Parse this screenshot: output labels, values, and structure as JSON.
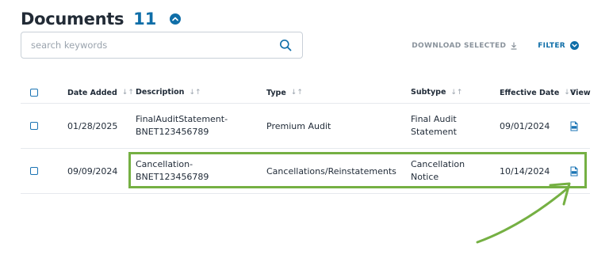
{
  "header": {
    "title": "Documents",
    "count": "11"
  },
  "search": {
    "placeholder": "search keywords",
    "value": ""
  },
  "actions": {
    "download_label": "DOWNLOAD SELECTED",
    "filter_label": "FILTER"
  },
  "table": {
    "columns": [
      "Date Added",
      "Description",
      "Type",
      "Subtype",
      "Effective Date",
      "View"
    ],
    "rows": [
      {
        "date_added": "01/28/2025",
        "description_line1": "FinalAuditStatement-",
        "description_line2": "BNET123456789",
        "type": "Premium Audit",
        "subtype_line1": "Final Audit",
        "subtype_line2": "Statement",
        "effective_date": "09/01/2024",
        "view_icon": "pdf-file-icon"
      },
      {
        "date_added": "09/09/2024",
        "description_line1": "Cancellation-",
        "description_line2": "BNET123456789",
        "type": "Cancellations/Reinstatements",
        "subtype_line1": "Cancellation",
        "subtype_line2": "Notice",
        "effective_date": "10/14/2024",
        "view_icon": "pdf-file-icon"
      }
    ]
  },
  "colors": {
    "accent": "#0f6ea8",
    "highlight": "#75b043",
    "muted": "#8a939c"
  }
}
